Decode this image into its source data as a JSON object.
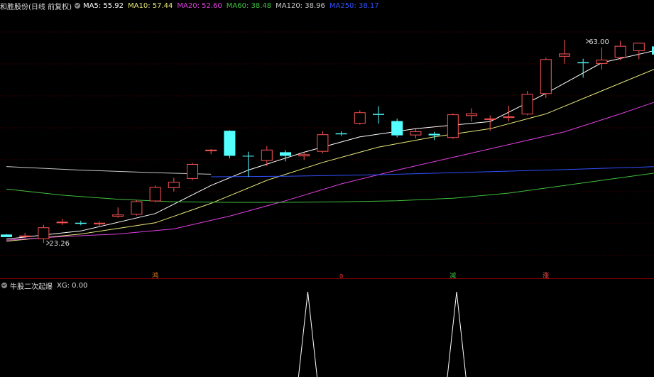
{
  "header": {
    "stock_name": "和胜股份(日线 前复权)",
    "ma": [
      {
        "label": "MA5: 55.92",
        "color": "#ffffff"
      },
      {
        "label": "MA10: 57.44",
        "color": "#e8e87a"
      },
      {
        "label": "MA20: 52.60",
        "color": "#e040e0"
      },
      {
        "label": "MA60: 38.48",
        "color": "#40c040"
      },
      {
        "label": "MA120: 38.96",
        "color": "#c8c8c8"
      },
      {
        "label": "MA250: 38.17",
        "color": "#3050ff"
      }
    ]
  },
  "indicator": {
    "name": "牛股二次起爆",
    "value_label": "XG: 0.00"
  },
  "chart_data": [
    {
      "type": "candlestick",
      "ylim": [
        18,
        68
      ],
      "up_color": "#ff5555",
      "down_color": "#54ffff",
      "annotations": [
        {
          "text": "63.00",
          "x": 31,
          "y": 63.0
        },
        {
          "text": "23.26",
          "x": 2,
          "y": 23.26
        }
      ],
      "signal_markers": [
        {
          "text": "鸿",
          "x": 8,
          "color": "#e08020"
        },
        {
          "text": "a",
          "x": 18,
          "color": "#ff3030"
        },
        {
          "text": "减",
          "x": 24,
          "color": "#40c040"
        },
        {
          "text": "涨",
          "x": 29,
          "color": "#ff5050"
        }
      ],
      "candles": [
        {
          "o": 24.9,
          "h": 25.0,
          "l": 24.4,
          "c": 24.4
        },
        {
          "o": 24.7,
          "h": 25.2,
          "l": 24.2,
          "c": 24.7
        },
        {
          "o": 24.0,
          "h": 26.8,
          "l": 23.26,
          "c": 26.3
        },
        {
          "o": 27.2,
          "h": 28.0,
          "l": 26.8,
          "c": 27.4
        },
        {
          "o": 27.2,
          "h": 27.6,
          "l": 26.7,
          "c": 27.0
        },
        {
          "o": 26.9,
          "h": 27.5,
          "l": 26.4,
          "c": 27.2
        },
        {
          "o": 28.4,
          "h": 30.2,
          "l": 28.2,
          "c": 28.8
        },
        {
          "o": 28.8,
          "h": 31.6,
          "l": 28.6,
          "c": 31.4
        },
        {
          "o": 31.4,
          "h": 34.5,
          "l": 31.2,
          "c": 34.2
        },
        {
          "o": 34.0,
          "h": 36.0,
          "l": 33.3,
          "c": 35.2
        },
        {
          "o": 35.8,
          "h": 38.9,
          "l": 35.5,
          "c": 38.7
        },
        {
          "o": 41.2,
          "h": 41.6,
          "l": 40.6,
          "c": 41.5
        },
        {
          "o": 45.2,
          "h": 45.3,
          "l": 39.8,
          "c": 40.3
        },
        {
          "o": 40.3,
          "h": 41.1,
          "l": 36.2,
          "c": 40.2
        },
        {
          "o": 39.3,
          "h": 42.2,
          "l": 38.3,
          "c": 41.5
        },
        {
          "o": 41.0,
          "h": 41.4,
          "l": 39.2,
          "c": 40.3
        },
        {
          "o": 40.2,
          "h": 41.0,
          "l": 39.5,
          "c": 40.6
        },
        {
          "o": 41.1,
          "h": 45.1,
          "l": 40.8,
          "c": 44.5
        },
        {
          "o": 44.7,
          "h": 45.1,
          "l": 44.2,
          "c": 44.5
        },
        {
          "o": 46.6,
          "h": 49.2,
          "l": 46.4,
          "c": 48.8
        },
        {
          "o": 48.5,
          "h": 50.0,
          "l": 46.6,
          "c": 48.3
        },
        {
          "o": 47.1,
          "h": 47.6,
          "l": 43.9,
          "c": 44.3
        },
        {
          "o": 44.3,
          "h": 45.5,
          "l": 43.7,
          "c": 45.1
        },
        {
          "o": 44.6,
          "h": 45.0,
          "l": 43.4,
          "c": 44.3
        },
        {
          "o": 43.8,
          "h": 48.6,
          "l": 43.6,
          "c": 48.4
        },
        {
          "o": 48.1,
          "h": 49.6,
          "l": 47.0,
          "c": 48.6
        },
        {
          "o": 47.4,
          "h": 48.2,
          "l": 45.2,
          "c": 47.6
        },
        {
          "o": 47.7,
          "h": 50.1,
          "l": 47.0,
          "c": 48.0
        },
        {
          "o": 48.4,
          "h": 53.0,
          "l": 48.2,
          "c": 52.4
        },
        {
          "o": 52.4,
          "h": 59.5,
          "l": 51.6,
          "c": 59.2
        },
        {
          "o": 59.7,
          "h": 63.0,
          "l": 58.3,
          "c": 60.3
        },
        {
          "o": 58.6,
          "h": 59.3,
          "l": 55.6,
          "c": 58.4
        },
        {
          "o": 58.3,
          "h": 61.5,
          "l": 57.2,
          "c": 59.1
        },
        {
          "o": 59.5,
          "h": 62.8,
          "l": 59.0,
          "c": 61.8
        },
        {
          "o": 60.8,
          "h": 62.4,
          "l": 59.2,
          "c": 62.4
        },
        {
          "o": 61.7,
          "h": 62.0,
          "l": 59.6,
          "c": 60.1
        }
      ],
      "series": [
        {
          "name": "MA5",
          "color": "#ffffff",
          "x": [
            0,
            4,
            8,
            11,
            13,
            16,
            19,
            22,
            26,
            29,
            32,
            35
          ],
          "values": [
            24.0,
            25.6,
            29.0,
            34.5,
            37.5,
            41.0,
            44.0,
            45.6,
            47.0,
            52.5,
            58.5,
            61.0
          ]
        },
        {
          "name": "MA10",
          "color": "#e8e87a",
          "x": [
            0,
            4,
            8,
            11,
            14,
            17,
            20,
            23,
            26,
            29,
            32,
            35
          ],
          "values": [
            23.6,
            25.0,
            27.2,
            31.0,
            35.5,
            39.0,
            42.0,
            44.0,
            45.6,
            48.5,
            53.0,
            57.5
          ]
        },
        {
          "name": "MA20",
          "color": "#e040e0",
          "x": [
            0,
            3,
            6,
            9,
            12,
            15,
            18,
            21,
            24,
            27,
            30,
            33,
            35
          ],
          "values": [
            23.8,
            24.5,
            25.0,
            26.0,
            28.5,
            31.5,
            34.8,
            37.5,
            40.0,
            42.5,
            45.0,
            48.5,
            51.0
          ]
        },
        {
          "name": "MA60",
          "color": "#40c040",
          "x": [
            0,
            3,
            6,
            9,
            12,
            15,
            18,
            21,
            24,
            27,
            30,
            33,
            35
          ],
          "values": [
            33.8,
            32.6,
            31.8,
            31.3,
            31.2,
            31.2,
            31.3,
            31.5,
            32.0,
            33.0,
            34.5,
            36.0,
            37.0
          ]
        },
        {
          "name": "MA120",
          "color": "#c8c8c8",
          "x": [
            0,
            4,
            8,
            11
          ],
          "values": [
            38.2,
            37.5,
            37.0,
            36.7
          ]
        },
        {
          "name": "MA250",
          "color": "#3050ff",
          "x": [
            11,
            15,
            20,
            25,
            30,
            35
          ],
          "values": [
            36.2,
            36.3,
            36.6,
            37.1,
            37.6,
            38.2
          ]
        }
      ]
    },
    {
      "type": "line",
      "title": "牛股二次起爆",
      "series": [
        {
          "name": "XG",
          "color": "#ffffff"
        }
      ],
      "ylim": [
        0,
        1
      ],
      "spikes": [
        {
          "x_left": 15.7,
          "x_peak": 16.2,
          "x_right": 16.7,
          "value": 1
        },
        {
          "x_left": 23.7,
          "x_peak": 24.2,
          "x_right": 24.7,
          "value": 1
        }
      ]
    }
  ]
}
